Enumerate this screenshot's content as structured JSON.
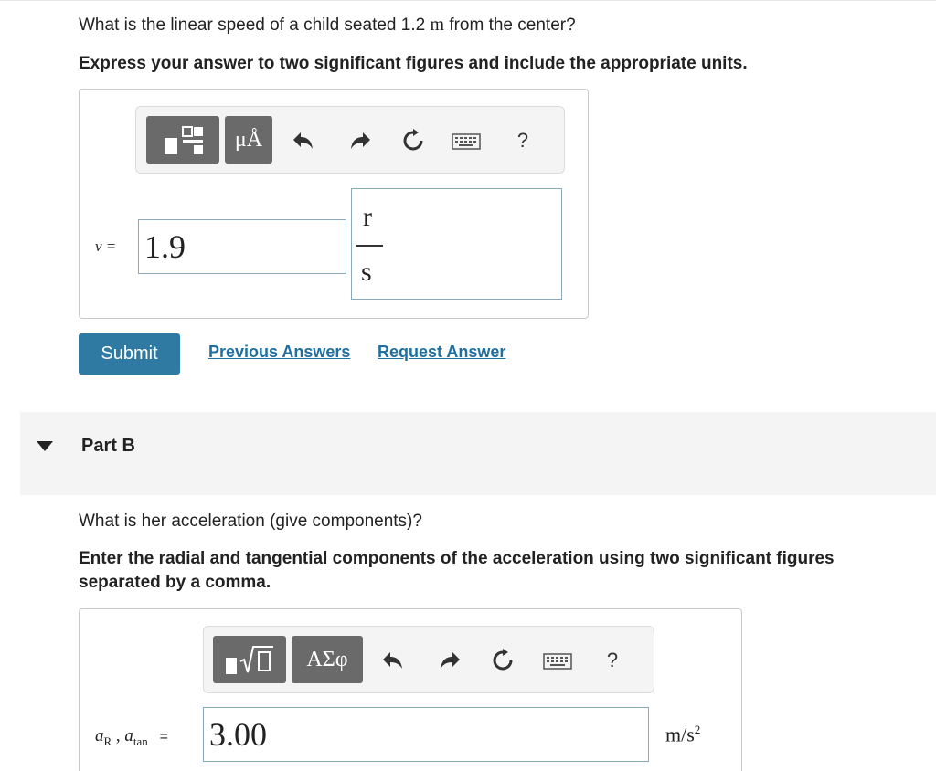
{
  "partA": {
    "question_prefix": "What is the linear speed of a child seated 1.2",
    "question_unit": "m",
    "question_suffix": "from the center?",
    "instruction": "Express your answer to two significant figures and include the appropriate units.",
    "toolbar": {
      "units_button": "μÅ",
      "help": "?"
    },
    "variable_label": "v =",
    "value": "1.9",
    "unit_numerator": "r",
    "unit_denominator": "s",
    "submit_label": "Submit",
    "previous_answers_label": "Previous Answers",
    "request_answer_label": "Request Answer"
  },
  "partB": {
    "header": "Part B",
    "question": "What is her acceleration (give components)?",
    "instruction_line1": "Enter the radial and tangential components of the acceleration using two significant figures",
    "instruction_line2": "separated by a comma.",
    "toolbar": {
      "symbols_button": "ΑΣφ",
      "help": "?"
    },
    "label_a": "a",
    "label_r_sub": "R",
    "label_sep": ",",
    "label_tan_sub": "tan",
    "label_eq": "=",
    "value": "3.00",
    "unit": "m/s",
    "unit_exp": "2"
  },
  "colors": {
    "submit": "#2e7aa3",
    "link": "#1f6fa0",
    "field_border": "#8aa9bb"
  }
}
